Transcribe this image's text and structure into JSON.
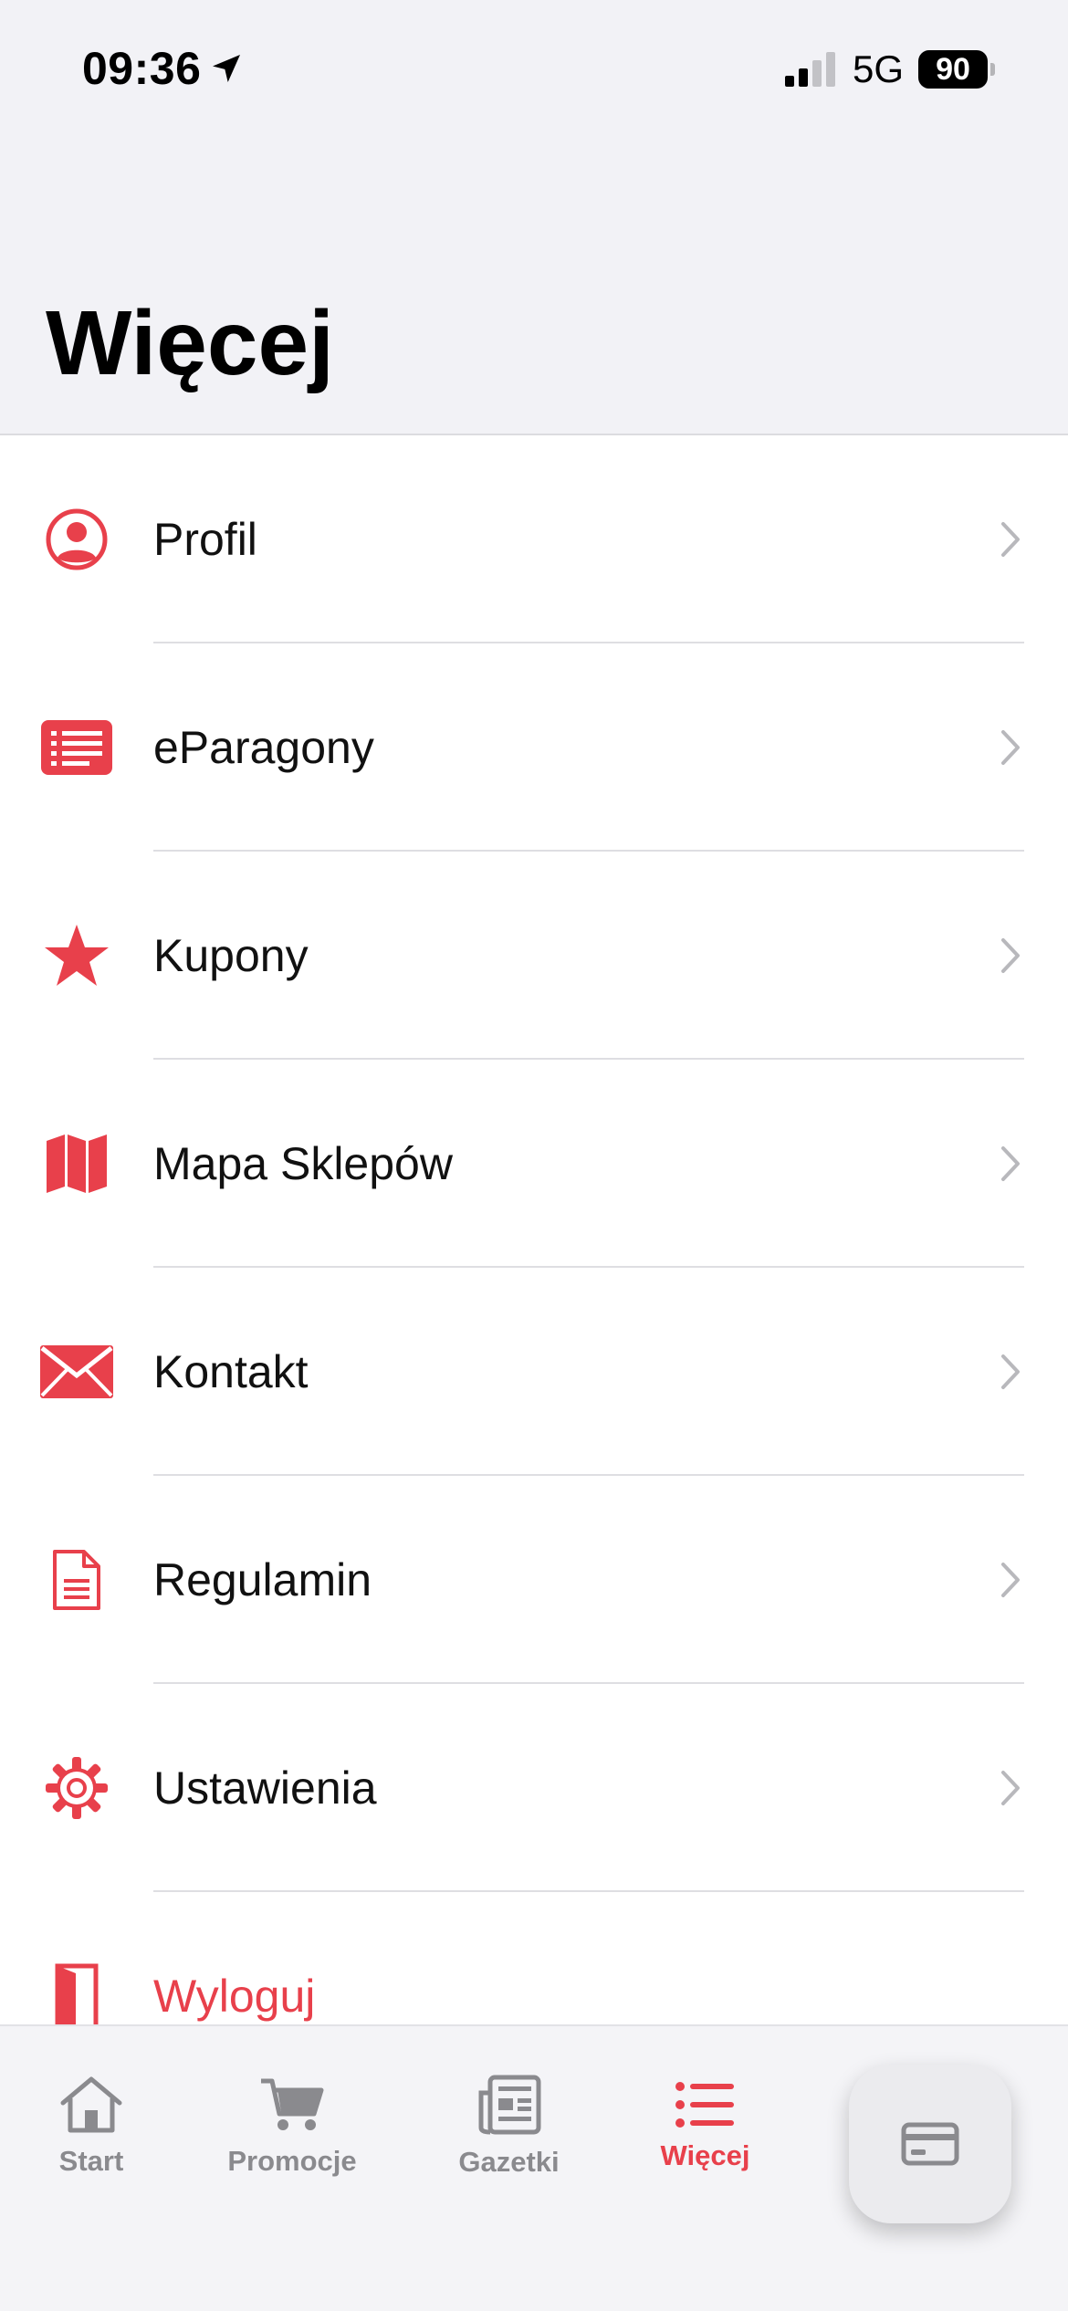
{
  "status_bar": {
    "time": "09:36",
    "network": "5G",
    "battery": "90"
  },
  "header": {
    "title": "Więcej"
  },
  "menu": {
    "items": [
      {
        "label": "Profil",
        "icon": "person-circle-icon"
      },
      {
        "label": "eParagony",
        "icon": "receipt-list-icon"
      },
      {
        "label": "Kupony",
        "icon": "star-icon"
      },
      {
        "label": "Mapa Sklepów",
        "icon": "map-icon"
      },
      {
        "label": "Kontakt",
        "icon": "envelope-icon"
      },
      {
        "label": "Regulamin",
        "icon": "document-icon"
      },
      {
        "label": "Ustawienia",
        "icon": "gear-icon"
      },
      {
        "label": "Wyloguj",
        "icon": "door-icon"
      }
    ]
  },
  "tabbar": {
    "tabs": [
      {
        "label": "Start",
        "icon": "house-icon"
      },
      {
        "label": "Promocje",
        "icon": "cart-icon"
      },
      {
        "label": "Gazetki",
        "icon": "newspaper-icon"
      },
      {
        "label": "Więcej",
        "icon": "list-icon"
      }
    ],
    "active_tab": "Więcej",
    "fab_icon": "card-icon"
  },
  "colors": {
    "accent": "#e8404b",
    "header_bg": "#f2f2f6",
    "tab_inactive": "#8a8a8e"
  }
}
